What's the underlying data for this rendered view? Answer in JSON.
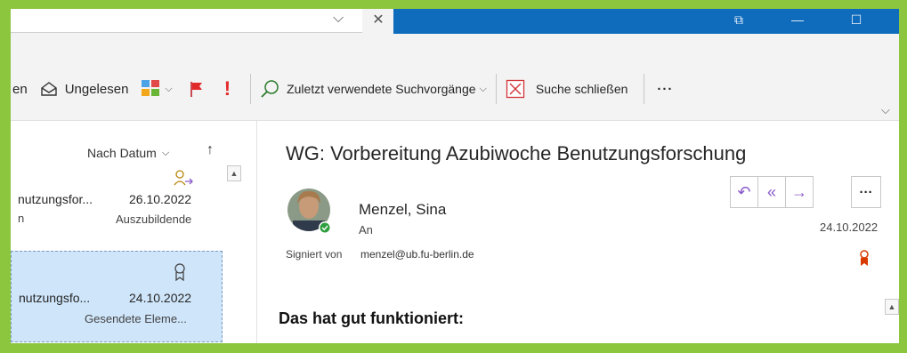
{
  "window": {
    "minimize_glyph": "—",
    "maximize_glyph": "☐",
    "close_glyph": "✕",
    "restore_glyph": "⧉"
  },
  "ribbon": {
    "partial_label": "en",
    "unread_label": "Ungelesen",
    "recent_searches_label": "Zuletzt verwendete Suchvorgänge",
    "close_search_label": "Suche schließen",
    "more_label": "···"
  },
  "list": {
    "sort_label": "Nach Datum",
    "items": [
      {
        "subject": "nutzungsfor...",
        "date": "26.10.2022",
        "sender_partial": "n",
        "folder": "Auszubildende"
      },
      {
        "subject": "nutzungsfo...",
        "date": "24.10.2022",
        "folder": "Gesendete Eleme..."
      }
    ]
  },
  "reading": {
    "subject": "WG: Vorbereitung Azubiwoche Benutzungsforschung",
    "sender": "Menzel, Sina",
    "to_label": "An",
    "date": "24.10.2022",
    "signed_by_label": "Signiert von",
    "signed_by_email": "menzel@ub.fu-berlin.de",
    "body_heading": "Das hat gut funktioniert:",
    "more_label": "···"
  },
  "colors": {
    "accent_blue": "#0f6cbd",
    "frame_green": "#8cc63f",
    "flag_red": "#e32a2a",
    "action_purple": "#8a59c9"
  }
}
